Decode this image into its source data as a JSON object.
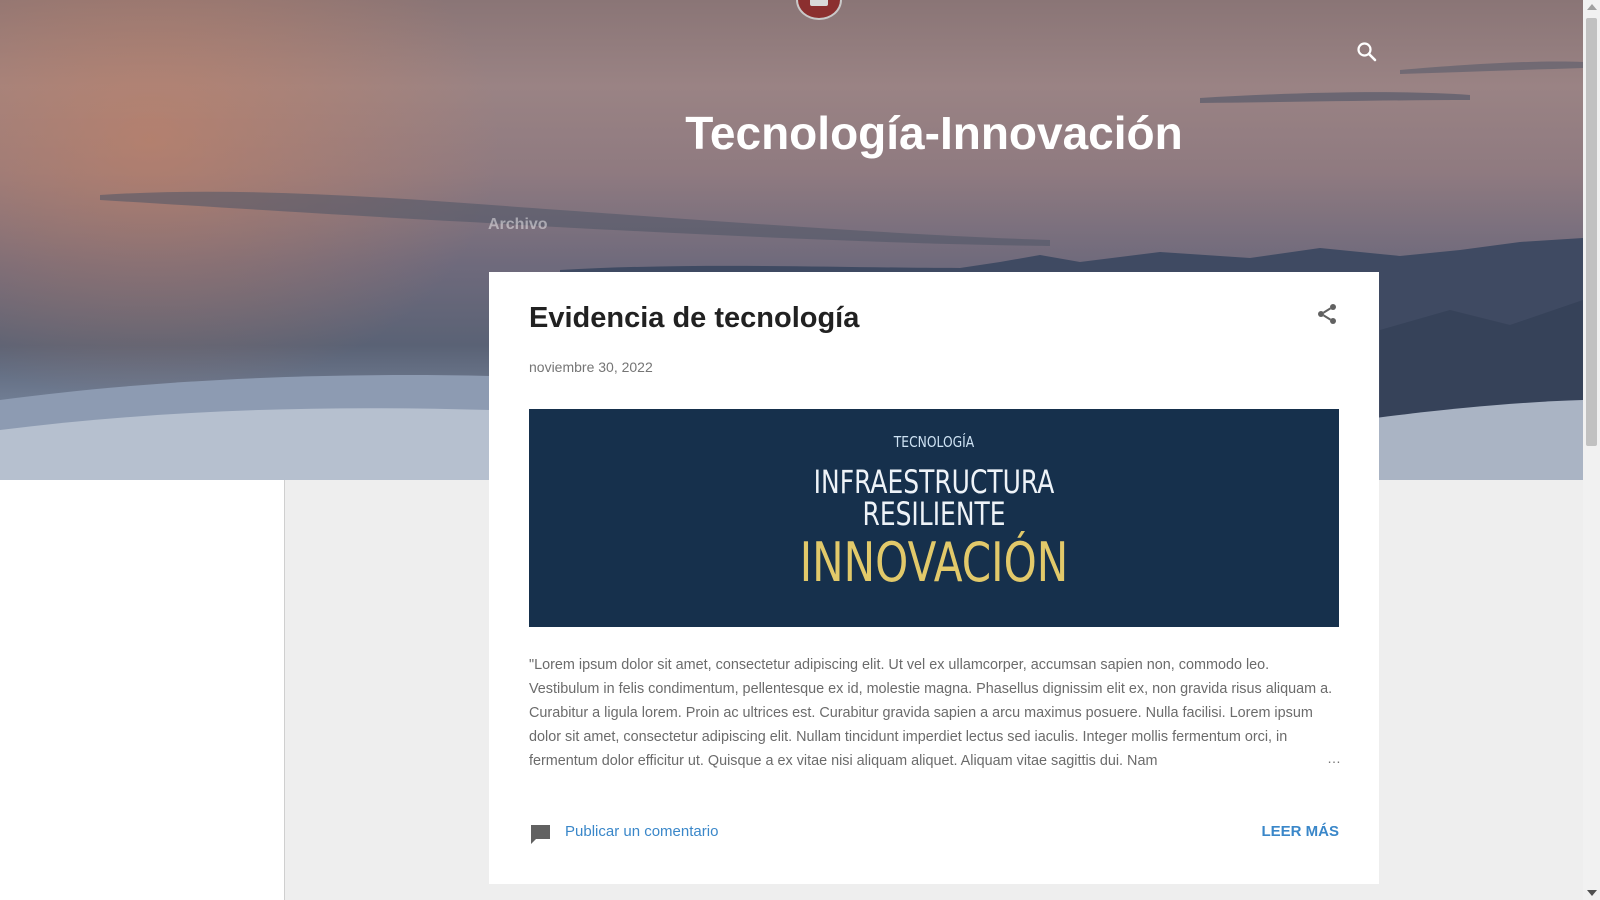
{
  "header": {
    "blog_title": "Tecnología-Innovación",
    "nav": {
      "archivo": "Archivo"
    },
    "icons": {
      "search": "search-icon",
      "avatar": "profile-avatar"
    }
  },
  "post": {
    "title": "Evidencia de tecnología",
    "date": "noviembre 30, 2022",
    "image": {
      "line1": "TECNOLOGÍA",
      "line2": "INFRAESTRUCTURA",
      "line3": "RESILIENTE",
      "line4": "INNOVACIÓN"
    },
    "snippet": "\"Lorem ipsum dolor sit amet, consectetur adipiscing elit. Ut vel ex ullamcorper, accumsan sapien non, commodo leo. Vestibulum in felis condimentum, pellentesque ex id, molestie magna. Phasellus dignissim elit ex, non gravida risus aliquam a. Curabitur a ligula lorem. Proin ac ultrices est. Curabitur gravida sapien a arcu maximus posuere. Nulla facilisi. Lorem ipsum dolor sit amet, consectetur adipiscing elit.  Nullam tincidunt imperdiet lectus sed iaculis. Integer mollis fermentum orci, in fermentum dolor efficitur ut. Quisque a ex vitae nisi aliquam aliquet. Aliquam vitae sagittis dui. Nam",
    "ellipsis": "…",
    "comment_label": "Publicar un comentario",
    "read_more": "LEER MÁS",
    "icons": {
      "share": "share-icon",
      "comment": "comment-icon"
    }
  },
  "colors": {
    "link": "#3a87c9",
    "image_bg": "#16304c",
    "image_accent": "#e2c96a"
  }
}
